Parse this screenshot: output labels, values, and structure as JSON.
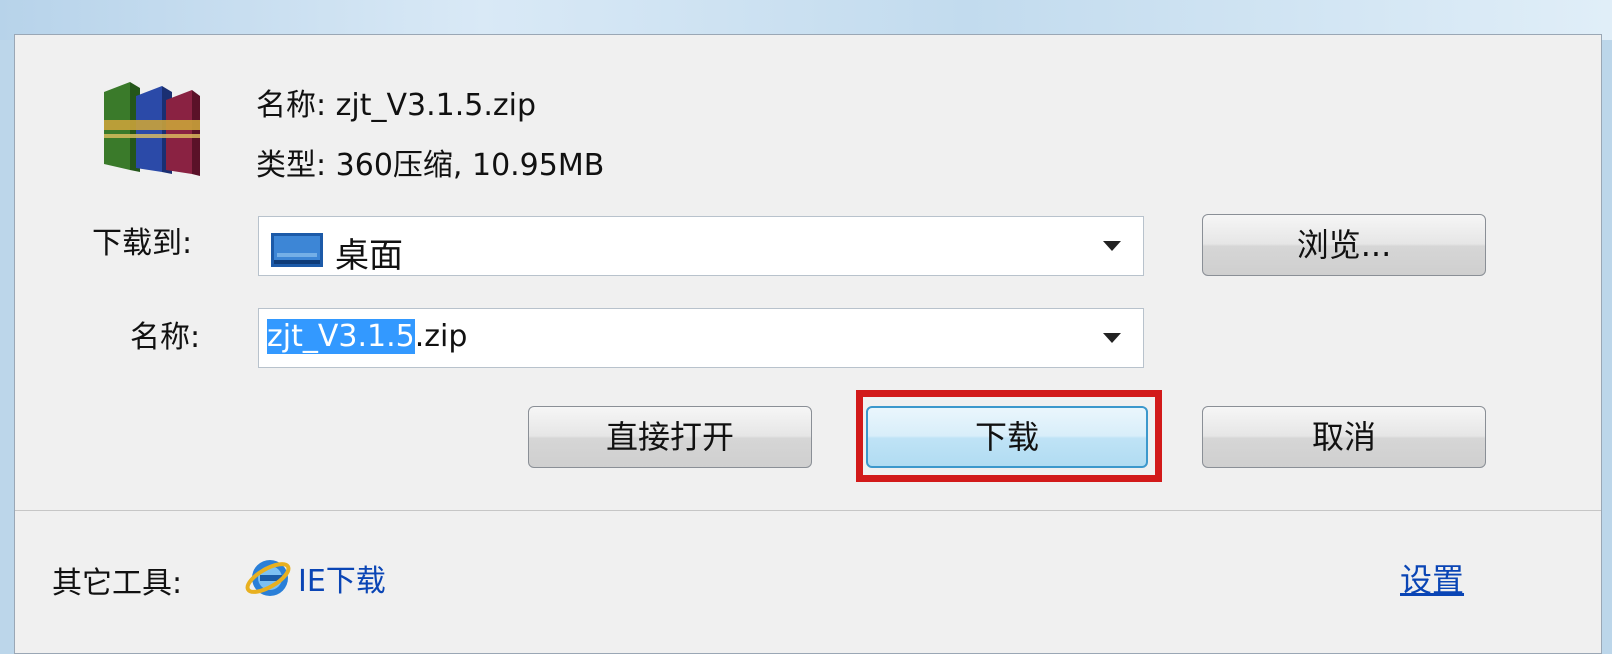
{
  "file": {
    "name_line": "名称: zjt_V3.1.5.zip",
    "type_line": "类型: 360压缩, 10.95MB",
    "icon": "winrar-archive-icon"
  },
  "download_to": {
    "label": "下载到:",
    "value": "桌面",
    "icon": "desktop-folder-icon"
  },
  "filename": {
    "label": "名称:",
    "selected_part": "zjt_V3.1.5",
    "rest_part": ".zip"
  },
  "buttons": {
    "browse": "浏览...",
    "open": "直接打开",
    "download": "下载",
    "cancel": "取消"
  },
  "footer": {
    "other_tools_label": "其它工具:",
    "ie_download": "IE下载",
    "settings": "设置"
  },
  "colors": {
    "highlight": "#d21a1a",
    "link": "#0a45b5",
    "selection": "#3399ff"
  }
}
